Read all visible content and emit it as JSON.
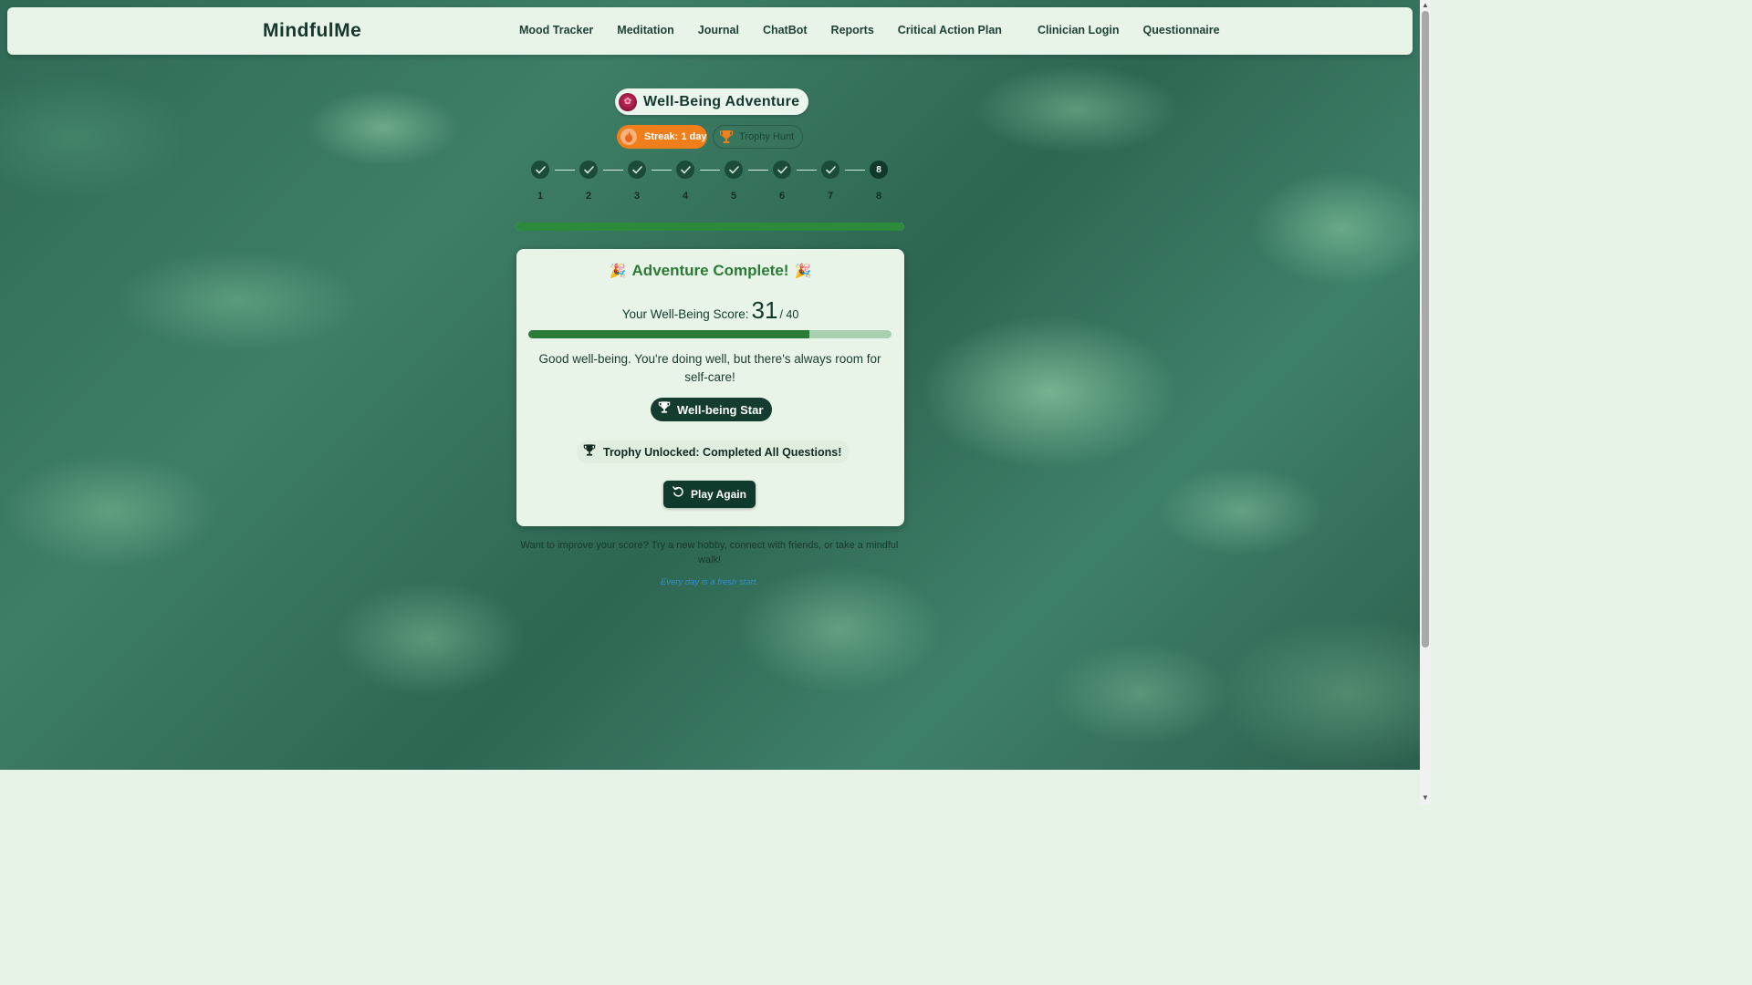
{
  "navbar": {
    "brand": "MindfulMe",
    "links": [
      "Mood Tracker",
      "Meditation",
      "Journal",
      "ChatBot",
      "Reports",
      "Critical Action Plan",
      "Clinician Login",
      "Questionnaire"
    ]
  },
  "game": {
    "title": "Well-Being Adventure",
    "streak": "Streak: 1 day",
    "trophy_hunt": "Trophy Hunt",
    "steps": [
      "1",
      "2",
      "3",
      "4",
      "5",
      "6",
      "7",
      "8"
    ],
    "current_step": "8",
    "progress_fraction": 1.0
  },
  "result": {
    "title": "Adventure Complete!",
    "score_label": "Your Well-Being Score:",
    "score": "31",
    "score_max": "/ 40",
    "score_fraction": 0.775,
    "feedback": "Good well-being. You're doing well, but there's always room for self-care!",
    "badge": "Well-being Star",
    "trophy_unlocked": "Trophy Unlocked: Completed All Questions!",
    "play_again": "Play Again"
  },
  "footer": {
    "tip": "Want to improve your score? Try a new hobby, connect with friends, or take a mindful walk!",
    "quote": "Every day is a fresh start."
  },
  "colors": {
    "accent_green": "#2c8a3b",
    "dark_green": "#103a2b",
    "streak_orange": "#f07e1a",
    "quote_blue": "#2f8fd0"
  },
  "icons": {
    "title": "rose-icon",
    "streak": "flame-icon",
    "trophy_hunt": "trophy-icon",
    "step_done": "check-icon",
    "badge": "trophy-icon",
    "play_again": "restart-icon",
    "celebration": "party-popper-icon"
  }
}
